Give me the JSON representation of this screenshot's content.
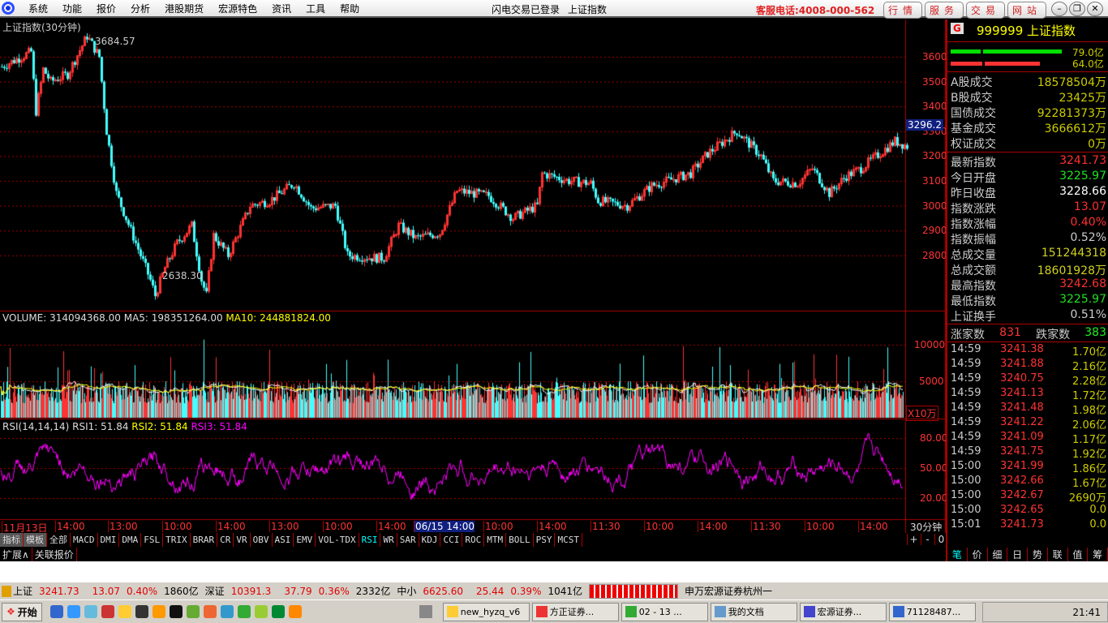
{
  "menubar": {
    "items": [
      "系统",
      "功能",
      "报价",
      "分析",
      "港股期货",
      "宏源特色",
      "资讯",
      "工具",
      "帮助"
    ],
    "login_status": "闪电交易已登录",
    "current": "上证指数",
    "hotline": "客服电话:4008-000-562",
    "nav": [
      "行情",
      "服务",
      "交易",
      "网站"
    ]
  },
  "chart": {
    "title": "上证指数(30分钟)",
    "high_label": "3684.57",
    "low_label": "2638.30",
    "current_price_tag": "3296.2",
    "price_ticks": [
      "3600",
      "3500",
      "3400",
      "3300",
      "3200",
      "3100",
      "3000",
      "2900",
      "2800"
    ],
    "price_path": [
      [
        0,
        3560
      ],
      [
        12,
        3620
      ],
      [
        14,
        3380
      ],
      [
        17,
        3550
      ],
      [
        20,
        3500
      ],
      [
        27,
        3530
      ],
      [
        35,
        3684
      ],
      [
        40,
        3600
      ],
      [
        43,
        3300
      ],
      [
        47,
        3050
      ],
      [
        53,
        2900
      ],
      [
        61,
        2700
      ],
      [
        63,
        2638
      ],
      [
        67,
        2750
      ],
      [
        72,
        2850
      ],
      [
        78,
        2920
      ],
      [
        82,
        2700
      ],
      [
        84,
        2640
      ],
      [
        87,
        2880
      ],
      [
        93,
        2800
      ],
      [
        102,
        3000
      ],
      [
        110,
        3020
      ],
      [
        120,
        3090
      ],
      [
        127,
        2990
      ],
      [
        137,
        3000
      ],
      [
        142,
        2800
      ],
      [
        153,
        2790
      ],
      [
        157,
        2790
      ],
      [
        163,
        2920
      ],
      [
        170,
        2870
      ],
      [
        180,
        2890
      ],
      [
        187,
        3060
      ],
      [
        200,
        3040
      ],
      [
        210,
        2950
      ],
      [
        220,
        3000
      ],
      [
        222,
        3130
      ],
      [
        233,
        3100
      ],
      [
        242,
        3090
      ],
      [
        245,
        3020
      ],
      [
        257,
        3000
      ],
      [
        267,
        3080
      ],
      [
        283,
        3130
      ],
      [
        290,
        3210
      ],
      [
        302,
        3300
      ],
      [
        312,
        3200
      ],
      [
        317,
        3100
      ],
      [
        327,
        3090
      ],
      [
        333,
        3150
      ],
      [
        340,
        3050
      ],
      [
        347,
        3120
      ],
      [
        353,
        3150
      ],
      [
        367,
        3260
      ],
      [
        372,
        3240
      ]
    ],
    "volume_label": "VOLUME: 314094368.00",
    "ma5_label": "MA5: 198351264.00",
    "ma10_label": "MA10: 244881824.00",
    "volume_ticks": [
      "10000",
      "5000"
    ],
    "volume_unit": "X10万",
    "rsi_label": "RSI(14,14,14)",
    "rsi1": "RSI1: 51.84",
    "rsi2": "RSI2: 51.84",
    "rsi3": "RSI3: 51.84",
    "rsi_ticks": [
      "80.00",
      "50.00",
      "20.00"
    ],
    "time_axis": [
      "11月13日",
      "14:00",
      "13:00",
      "10:00",
      "14:00",
      "13:00",
      "10:00",
      "14:00",
      "06/15 14:00",
      "10:00",
      "14:00",
      "11:30",
      "10:00",
      "14:00",
      "11:30",
      "10:00",
      "14:00"
    ],
    "period": "30分钟",
    "zoom_buttons": [
      "+",
      "-",
      "0"
    ]
  },
  "indicator_tabs": [
    "指标",
    "模板",
    "全部",
    "MACD",
    "DMI",
    "DMA",
    "FSL",
    "TRIX",
    "BRAR",
    "CR",
    "VR",
    "OBV",
    "ASI",
    "EMV",
    "VOL-TDX",
    "RSI",
    "WR",
    "SAR",
    "KDJ",
    "CCI",
    "ROC",
    "MTM",
    "BOLL",
    "PSY",
    "MCST"
  ],
  "active_indicator": "RSI",
  "extra_tabs": [
    "扩展∧",
    "关联报价"
  ],
  "quote": {
    "badge": "G",
    "code_name": "999999 上证指数",
    "bar1": "79.0亿",
    "bar2": "64.0亿",
    "volumes": [
      [
        "A股成交",
        "18578504万"
      ],
      [
        "B股成交",
        "23425万"
      ],
      [
        "国债成交",
        "92281373万"
      ],
      [
        "基金成交",
        "3666612万"
      ],
      [
        "权证成交",
        "0万"
      ]
    ],
    "stats": [
      [
        "最新指数",
        "3241.73",
        "#ff3030"
      ],
      [
        "今日开盘",
        "3225.97",
        "#20e020"
      ],
      [
        "昨日收盘",
        "3228.66",
        "#ffffff"
      ],
      [
        "指数涨跌",
        "13.07",
        "#ff3030"
      ],
      [
        "指数涨幅",
        "0.40%",
        "#ff3030"
      ],
      [
        "指数振幅",
        "0.52%",
        "#cccccc"
      ],
      [
        "总成交量",
        "151244318",
        "#d0d020"
      ],
      [
        "总成交额",
        "18601928万",
        "#d0d020"
      ],
      [
        "最高指数",
        "3242.68",
        "#ff3030"
      ],
      [
        "最低指数",
        "3225.97",
        "#20e020"
      ],
      [
        "上证换手",
        "0.51%",
        "#cccccc"
      ]
    ],
    "up_label": "涨家数",
    "up": "831",
    "down_label": "跌家数",
    "down": "383",
    "ticks": [
      [
        "14:59",
        "3241.38",
        "1.70亿"
      ],
      [
        "14:59",
        "3241.88",
        "2.16亿"
      ],
      [
        "14:59",
        "3240.75",
        "2.28亿"
      ],
      [
        "14:59",
        "3241.13",
        "1.72亿"
      ],
      [
        "14:59",
        "3241.48",
        "1.98亿"
      ],
      [
        "14:59",
        "3241.22",
        "2.06亿"
      ],
      [
        "14:59",
        "3241.09",
        "1.17亿"
      ],
      [
        "14:59",
        "3241.75",
        "1.92亿"
      ],
      [
        "15:00",
        "3241.99",
        "1.86亿"
      ],
      [
        "15:00",
        "3242.66",
        "1.67亿"
      ],
      [
        "15:00",
        "3242.67",
        "2690万"
      ],
      [
        "15:00",
        "3242.65",
        "0.0"
      ],
      [
        "15:01",
        "3241.73",
        "0.0"
      ]
    ],
    "bottom_tabs": [
      "笔",
      "价",
      "细",
      "日",
      "势",
      "联",
      "值",
      "筹"
    ]
  },
  "status": {
    "sh_label": "上证",
    "sh": "3241.73",
    "sh_chg": "13.07",
    "sh_pct": "0.40%",
    "sh_amt": "1860亿",
    "sz_label": "深证",
    "sz": "10391.3",
    "sz_chg": "37.79",
    "sz_pct": "0.36%",
    "sz_amt": "2332亿",
    "zx_label": "中小",
    "zx": "6625.60",
    "zx_chg": "25.44",
    "zx_pct": "0.39%",
    "zx_amt": "1041亿",
    "broker": "申万宏源证券杭州一"
  },
  "taskbar": {
    "start": "开始",
    "tasks": [
      "new_hyzq_v6",
      "方正证券...",
      "02 - 13 ...",
      "我的文档",
      "宏源证券...",
      "71128487..."
    ],
    "clock": "21:41"
  }
}
